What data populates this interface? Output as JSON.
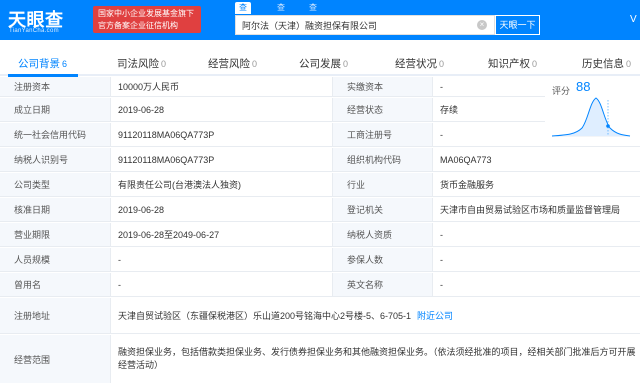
{
  "header": {
    "logo_text": "天眼查",
    "logo_sub": "TianYanCha.com",
    "badge_line1": "国家中小企业发展基金旗下",
    "badge_line2": "官方备案企业征信机构",
    "search_tabs": [
      "查公司",
      "查老板",
      "查关系"
    ],
    "search_value": "阿尔法（天津）融资担保有限公司",
    "search_button": "天眼一下",
    "clear_icon": "×",
    "right_glyph": "V"
  },
  "nav": {
    "tabs": [
      {
        "label": "公司背景",
        "count": "6"
      },
      {
        "label": "司法风险",
        "count": "0"
      },
      {
        "label": "经营风险",
        "count": "0"
      },
      {
        "label": "公司发展",
        "count": "0"
      },
      {
        "label": "经营状况",
        "count": "0"
      },
      {
        "label": "知识产权",
        "count": "0"
      },
      {
        "label": "历史信息",
        "count": "0"
      }
    ]
  },
  "score": {
    "label": "评分",
    "value": "88"
  },
  "info": {
    "rows": [
      {
        "l1": "注册资本",
        "v1": "10000万人民币",
        "l2": "实缴资本",
        "v2": "-"
      },
      {
        "l1": "成立日期",
        "v1": "2019-06-28",
        "l2": "经营状态",
        "v2": "存续"
      },
      {
        "l1": "统一社会信用代码",
        "v1": "91120118MA06QA773P",
        "l2": "工商注册号",
        "v2": "-"
      },
      {
        "l1": "纳税人识别号",
        "v1": "91120118MA06QA773P",
        "l2": "组织机构代码",
        "v2": "MA06QA773"
      },
      {
        "l1": "公司类型",
        "v1": "有限责任公司(台港澳法人独资)",
        "l2": "行业",
        "v2": "货币金融服务"
      },
      {
        "l1": "核准日期",
        "v1": "2019-06-28",
        "l2": "登记机关",
        "v2": "天津市自由贸易试验区市场和质量监督管理局"
      },
      {
        "l1": "营业期限",
        "v1": "2019-06-28至2049-06-27",
        "l2": "纳税人资质",
        "v2": "-"
      },
      {
        "l1": "人员规模",
        "v1": "-",
        "l2": "参保人数",
        "v2": "-"
      },
      {
        "l1": "曾用名",
        "v1": "-",
        "l2": "英文名称",
        "v2": "-"
      }
    ],
    "address_label": "注册地址",
    "address_value": "天津自贸试验区（东疆保税港区）乐山道200号铭海中心2号楼-5、6-705-1",
    "address_link": "附近公司",
    "scope_label": "经营范围",
    "scope_value": "融资担保业务，包括借款类担保业务、发行债券担保业务和其他融资担保业务。（依法须经批准的项目，经相关部门批准后方可开展经营活动）"
  },
  "colors": {
    "brand": "#0084ff",
    "badge": "#e04040",
    "label_bg": "#f5f8fc"
  }
}
